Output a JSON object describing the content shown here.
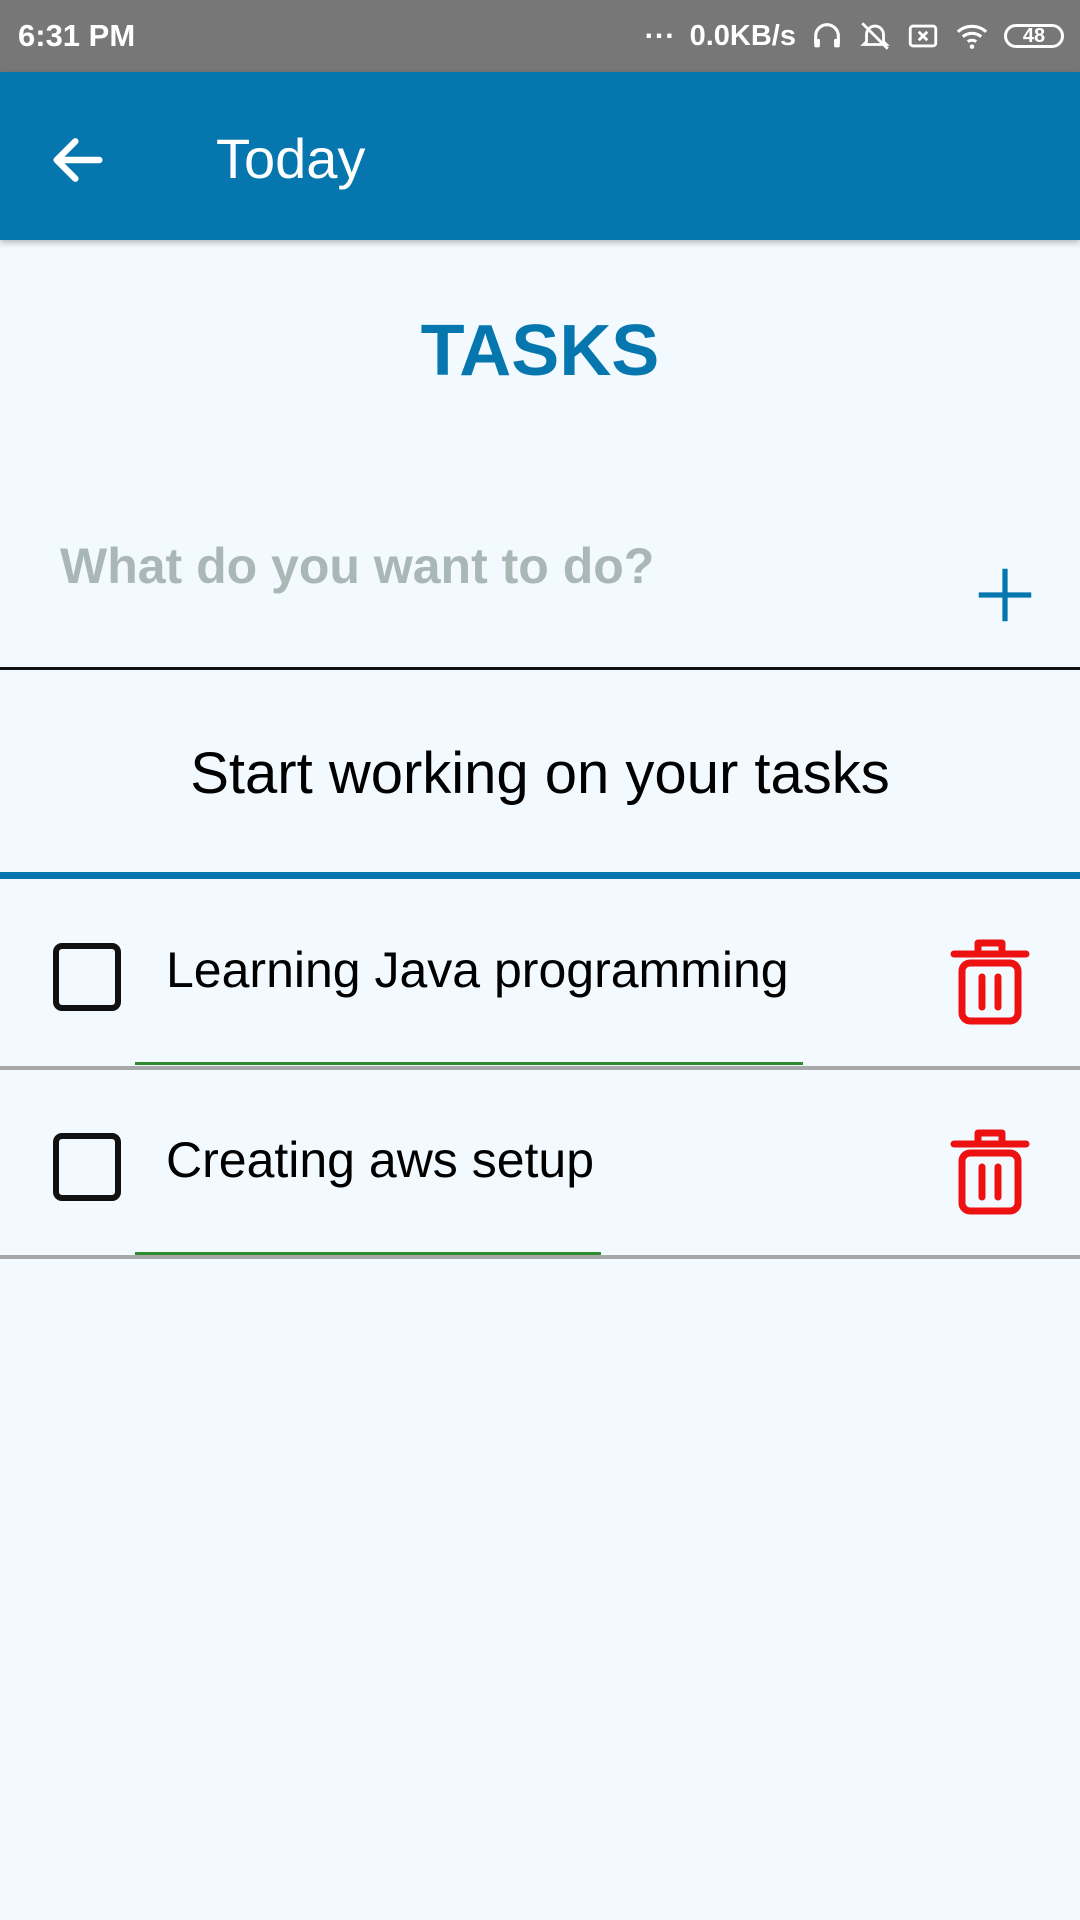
{
  "status_bar": {
    "time": "6:31 PM",
    "dots": "...",
    "network_speed": "0.0KB/s",
    "battery": "48",
    "icons": [
      "headphones-icon",
      "alarm-off-icon",
      "sim-off-icon",
      "wifi-icon",
      "battery-icon"
    ]
  },
  "app_bar": {
    "title": "Today",
    "back_icon": "arrow-back-icon"
  },
  "main": {
    "heading": "TASKS",
    "input_placeholder": "What do you want to do?",
    "input_value": "",
    "add_icon": "plus-icon",
    "section_heading": "Start working on your tasks"
  },
  "tasks": [
    {
      "label": "Learning Java programming",
      "checked": false,
      "delete_icon": "trash-icon"
    },
    {
      "label": "Creating aws setup",
      "checked": false,
      "delete_icon": "trash-icon"
    }
  ],
  "colors": {
    "primary": "#0677ae",
    "status_bar": "#777777",
    "background": "#f3faff",
    "delete": "#ee1111",
    "underline": "#2e8b2e",
    "placeholder": "#a9b8b6"
  }
}
